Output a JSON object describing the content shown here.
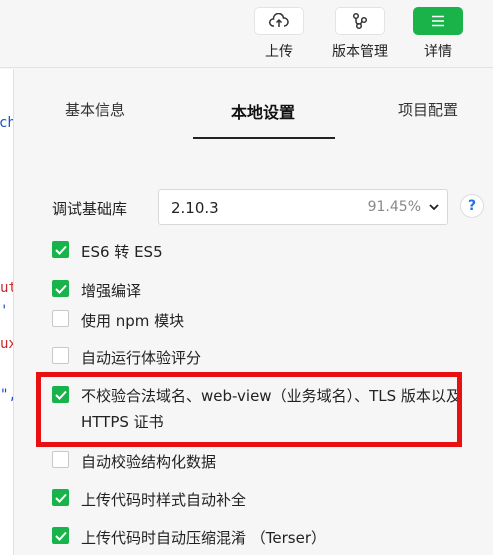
{
  "toolbar": {
    "upload_label": "上传",
    "version_label": "版本管理",
    "detail_label": "详情",
    "detail_color": "#19b34a"
  },
  "editor": {
    "fragments": [
      "ch",
      "ut",
      "'",
      "ux",
      "\","
    ]
  },
  "tabs": {
    "basic": "基本信息",
    "local": "本地设置",
    "project": "项目配置"
  },
  "debug_lib": {
    "label": "调试基础库",
    "version": "2.10.3",
    "percent": "91.45%",
    "help": "?"
  },
  "options": [
    {
      "label": "ES6 转 ES5",
      "checked": true
    },
    {
      "label": "增强编译",
      "checked": true
    },
    {
      "label": "使用 npm 模块",
      "checked": false
    },
    {
      "label": "自动运行体验评分",
      "checked": false
    },
    {
      "label": "不校验合法域名、web-view（业务域名）、TLS 版本以及 HTTPS 证书",
      "checked": true
    },
    {
      "label": "自动校验结构化数据",
      "checked": false
    },
    {
      "label": "上传代码时样式自动补全",
      "checked": true
    },
    {
      "label": "上传代码时自动压缩混淆 （Terser）",
      "checked": true
    }
  ],
  "highlight_color": "#e81010"
}
